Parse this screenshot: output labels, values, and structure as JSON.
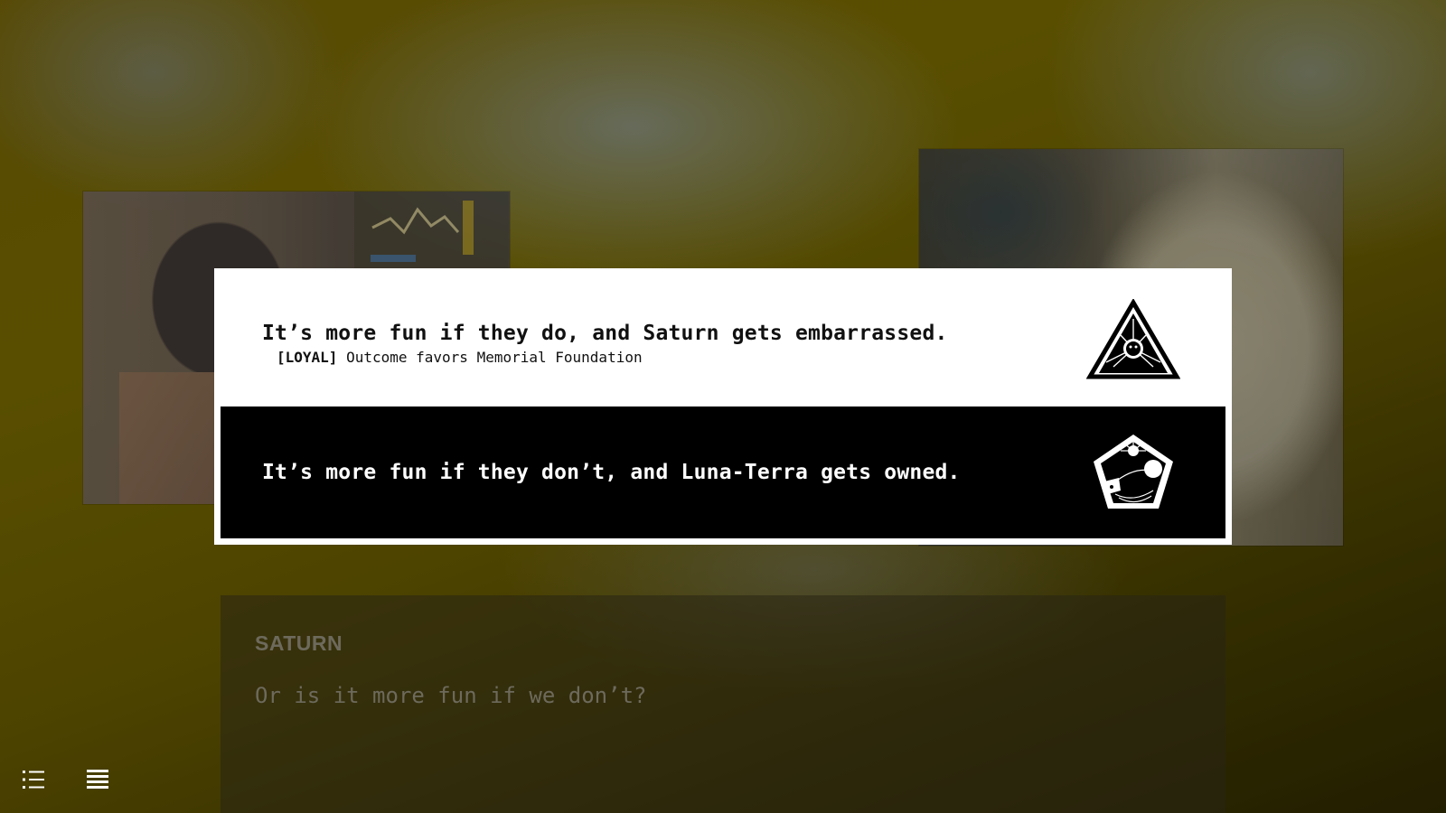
{
  "choices": [
    {
      "title": "It’s more fun if they do, and Saturn gets embarrassed.",
      "tag": "[LOYAL]",
      "subtitle": "Outcome favors Memorial Foundation",
      "icon": "memorial-foundation-triangle-icon"
    },
    {
      "title": "It’s more fun if they don’t, and Luna-Terra gets owned.",
      "icon": "luna-terra-pentagon-icon"
    }
  ],
  "dialogue": {
    "speaker": "SATURN",
    "line": "Or is it more fun if we don’t?"
  },
  "controls": {
    "list_icon": "list-icon",
    "menu_icon": "menu-icon"
  },
  "colors": {
    "background_accent": "#6d6000",
    "choice_selected_bg": "#000000",
    "choice_bg": "#ffffff",
    "dialogue_text": "#6d6a5c"
  }
}
